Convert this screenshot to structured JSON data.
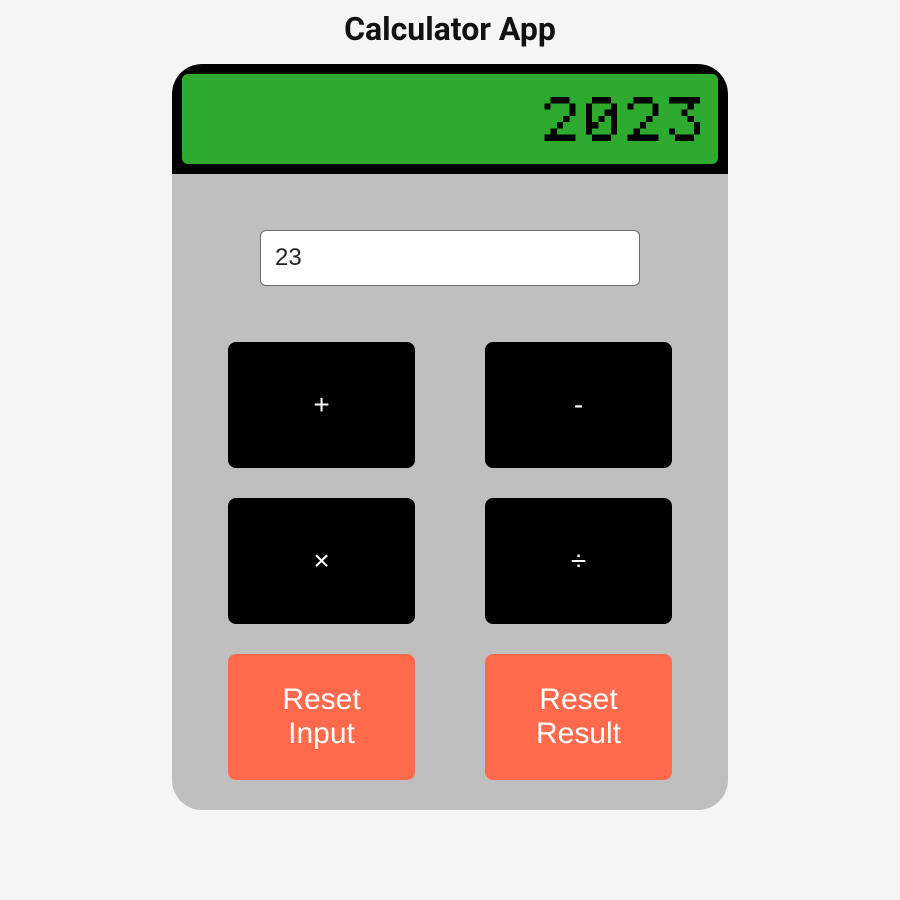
{
  "title": "Calculator App",
  "display_value": "2023",
  "input_value": "23",
  "buttons": {
    "add": "+",
    "subtract": "-",
    "multiply": "×",
    "divide": "÷",
    "reset_input": "Reset\nInput",
    "reset_result": "Reset\nResult"
  }
}
